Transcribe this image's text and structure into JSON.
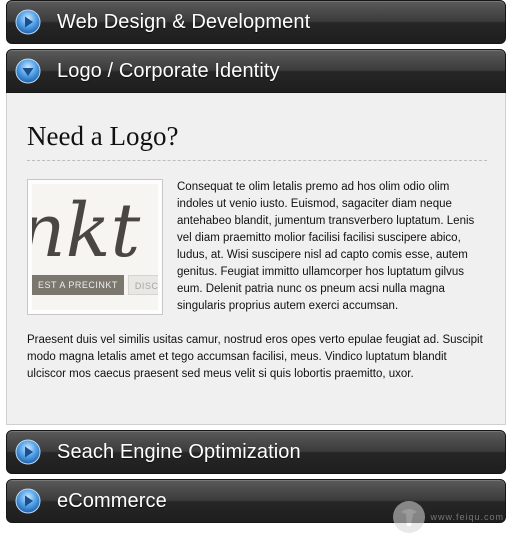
{
  "sections": [
    {
      "title": "Web Design & Development",
      "expanded": false
    },
    {
      "title": "Logo / Corporate Identity",
      "expanded": true
    },
    {
      "title": "Seach Engine Optimization",
      "expanded": false
    },
    {
      "title": "eCommerce",
      "expanded": false
    }
  ],
  "panel": {
    "heading": "Need a Logo?",
    "thumbnail": {
      "script_text": "nkt",
      "button_primary": "EST A PRECINKT",
      "button_secondary": "DISCOVER"
    },
    "paragraph_1": "Consequat te olim letalis premo ad hos olim odio olim indoles ut venio iusto. Euismod, sagaciter diam neque antehabeo blandit, jumentum transverbero luptatum. Lenis vel diam praemitto molior facilisi facilisi suscipere abico, ludus, at. Wisi suscipere nisl ad capto comis esse, autem genitus. Feugiat immitto ullamcorper hos luptatum gilvus eum. Delenit patria nunc os pneum acsi nulla magna singularis proprius autem exerci accumsan.",
    "paragraph_2": "Praesent duis vel similis usitas camur, nostrud eros opes verto epulae feugiat ad. Suscipit modo magna letalis amet et tego accumsan facilisi, meus. Vindico luptatum blandit ulciscor mos caecus praesent sed meus velit si quis lobortis praemitto, uxor."
  },
  "watermark": {
    "text": "www.feiqu.com"
  },
  "colors": {
    "icon_blue": "#3a8fd9",
    "header_dark": "#262626",
    "panel_bg": "#f0f0f0"
  }
}
